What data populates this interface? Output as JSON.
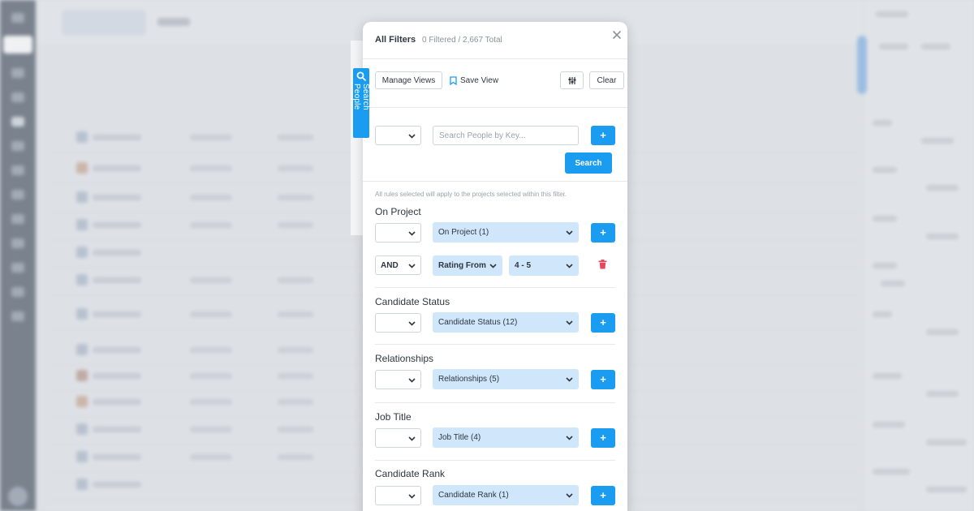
{
  "modal": {
    "title": "All Filters",
    "count": "0 Filtered / 2,667 Total",
    "toolbar": {
      "manage_views": "Manage Views",
      "save_view": "Save View",
      "clear": "Clear"
    },
    "search": {
      "placeholder": "Search People by Key...",
      "button": "Search"
    },
    "note": "All rules selected will apply to the projects selected within this filter.",
    "sections": [
      {
        "title": "On Project",
        "select": "On Project (1)",
        "rule": {
          "operator": "AND",
          "field": "Rating From",
          "value": "4 - 5"
        }
      },
      {
        "title": "Candidate Status",
        "select": "Candidate Status (12)"
      },
      {
        "title": "Relationships",
        "select": "Relationships (5)"
      },
      {
        "title": "Job Title",
        "select": "Job Title (4)"
      },
      {
        "title": "Candidate Rank",
        "select": "Candidate Rank (1)"
      }
    ]
  },
  "side_tab": {
    "label": "Search People",
    "icon": "search-icon"
  },
  "colors": {
    "accent": "#1a9cf0",
    "select_fill": "#cfe6fb",
    "delete": "#e8475b"
  }
}
